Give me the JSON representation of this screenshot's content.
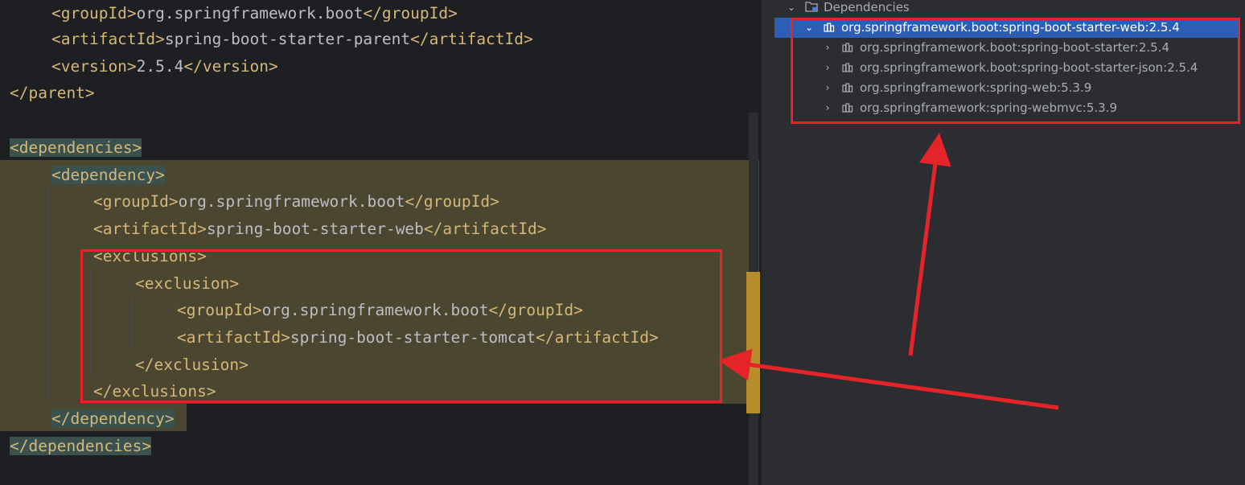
{
  "editor": {
    "lines": [
      {
        "open": "<groupId>",
        "text": "org.springframework.boot",
        "close": "</groupId>"
      },
      {
        "open": "<artifactId>",
        "text": "spring-boot-starter-parent",
        "close": "</artifactId>"
      },
      {
        "open": "<version>",
        "text": "2.5.4",
        "close": "</version>"
      },
      {
        "open": "</parent>",
        "text": "",
        "close": ""
      },
      {
        "open": "<dependencies>",
        "text": "",
        "close": ""
      },
      {
        "open": "<dependency>",
        "text": "",
        "close": ""
      },
      {
        "open": "<groupId>",
        "text": "org.springframework.boot",
        "close": "</groupId>"
      },
      {
        "open": "<artifactId>",
        "text": "spring-boot-starter-web",
        "close": "</artifactId>"
      },
      {
        "open": "<exclusions>",
        "text": "",
        "close": ""
      },
      {
        "open": "<exclusion>",
        "text": "",
        "close": ""
      },
      {
        "open": "<groupId>",
        "text": "org.springframework.boot",
        "close": "</groupId>"
      },
      {
        "open": "<artifactId>",
        "text": "spring-boot-starter-tomcat",
        "close": "</artifactId>"
      },
      {
        "open": "</exclusion>",
        "text": "",
        "close": ""
      },
      {
        "open": "</exclusions>",
        "text": "",
        "close": ""
      },
      {
        "open": "</dependency>",
        "text": "",
        "close": ""
      },
      {
        "open": "</dependencies>",
        "text": "",
        "close": ""
      }
    ]
  },
  "tree": {
    "root_label": "Dependencies",
    "selected_label": "org.springframework.boot:spring-boot-starter-web:2.5.4",
    "children": [
      "org.springframework.boot:spring-boot-starter:2.5.4",
      "org.springframework.boot:spring-boot-starter-json:2.5.4",
      "org.springframework:spring-web:5.3.9",
      "org.springframework:spring-webmvc:5.3.9"
    ]
  },
  "colors": {
    "annotation": "#e5242a",
    "selection": "#2e5db5",
    "highlight_block": "#4a4630",
    "tag": "#d5b778"
  },
  "icons": [
    "chevron-down-icon",
    "chevron-right-icon",
    "folder-icon",
    "library-icon"
  ]
}
